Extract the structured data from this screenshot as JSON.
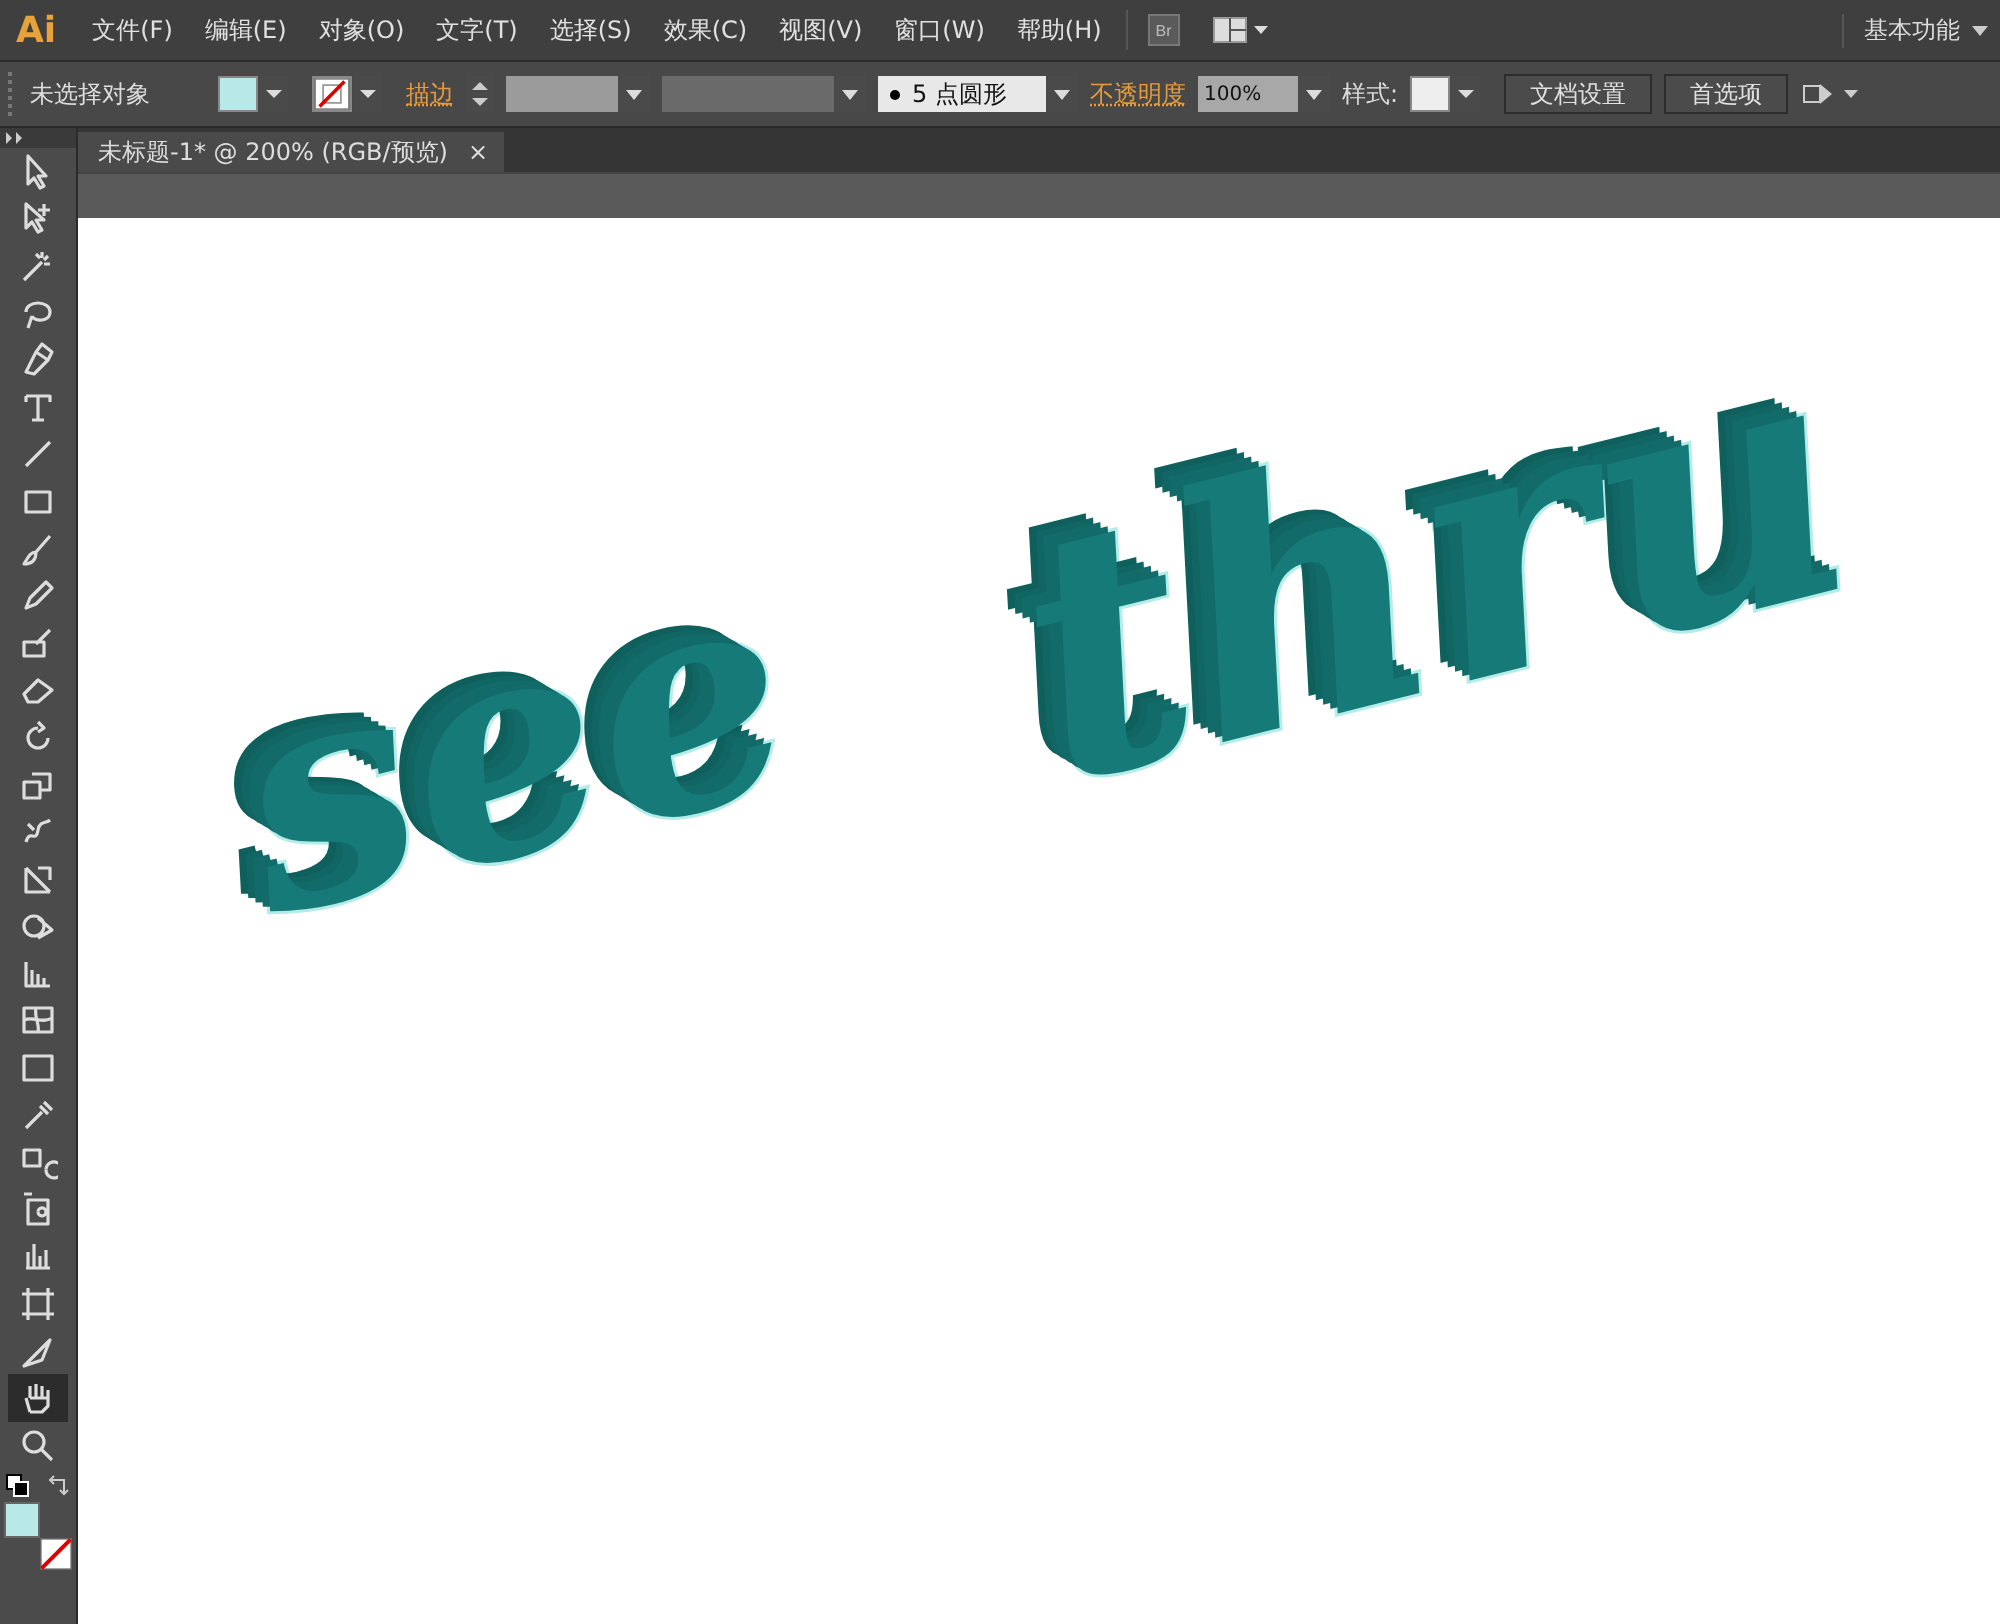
{
  "app": {
    "logo": "Ai",
    "workspace": "基本功能"
  },
  "menu": [
    {
      "label": "文件(F)"
    },
    {
      "label": "编辑(E)"
    },
    {
      "label": "对象(O)"
    },
    {
      "label": "文字(T)"
    },
    {
      "label": "选择(S)"
    },
    {
      "label": "效果(C)"
    },
    {
      "label": "视图(V)"
    },
    {
      "label": "窗口(W)"
    },
    {
      "label": "帮助(H)"
    }
  ],
  "bridge": {
    "label": "Br"
  },
  "control_bar": {
    "selection": "未选择对象",
    "stroke_label": "描边",
    "brush": "5 点圆形",
    "opacity_label": "不透明度",
    "opacity": "100%",
    "style_label": "样式:",
    "buttons": [
      "文档设置",
      "首选项"
    ]
  },
  "document_tab": {
    "title": "未标题-1* @ 200% (RGB/预览)",
    "close": "×"
  },
  "tools": [
    {
      "kind": "select",
      "selected": false
    },
    {
      "kind": "direct",
      "selected": false
    },
    {
      "kind": "wand",
      "selected": false
    },
    {
      "kind": "lasso",
      "selected": false
    },
    {
      "kind": "pen",
      "selected": false
    },
    {
      "kind": "type",
      "selected": false
    },
    {
      "kind": "line",
      "selected": false
    },
    {
      "kind": "rect",
      "selected": false
    },
    {
      "kind": "brush",
      "selected": false
    },
    {
      "kind": "pencil",
      "selected": false
    },
    {
      "kind": "blob",
      "selected": false
    },
    {
      "kind": "eraser",
      "selected": false
    },
    {
      "kind": "rotate",
      "selected": false
    },
    {
      "kind": "scale",
      "selected": false
    },
    {
      "kind": "warp",
      "selected": false
    },
    {
      "kind": "free",
      "selected": false
    },
    {
      "kind": "shape",
      "selected": false
    },
    {
      "kind": "grid",
      "selected": false
    },
    {
      "kind": "mesh",
      "selected": false
    },
    {
      "kind": "gradient",
      "selected": false
    },
    {
      "kind": "eyedropper",
      "selected": false
    },
    {
      "kind": "blend",
      "selected": false
    },
    {
      "kind": "symbol",
      "selected": false
    },
    {
      "kind": "graph",
      "selected": false
    },
    {
      "kind": "artboard",
      "selected": false
    },
    {
      "kind": "knife",
      "selected": false
    },
    {
      "kind": "hand",
      "selected": true
    },
    {
      "kind": "zoom",
      "selected": false
    }
  ],
  "canvas": {
    "artwork": [
      {
        "text": "see"
      },
      {
        "text": "thru"
      }
    ]
  }
}
